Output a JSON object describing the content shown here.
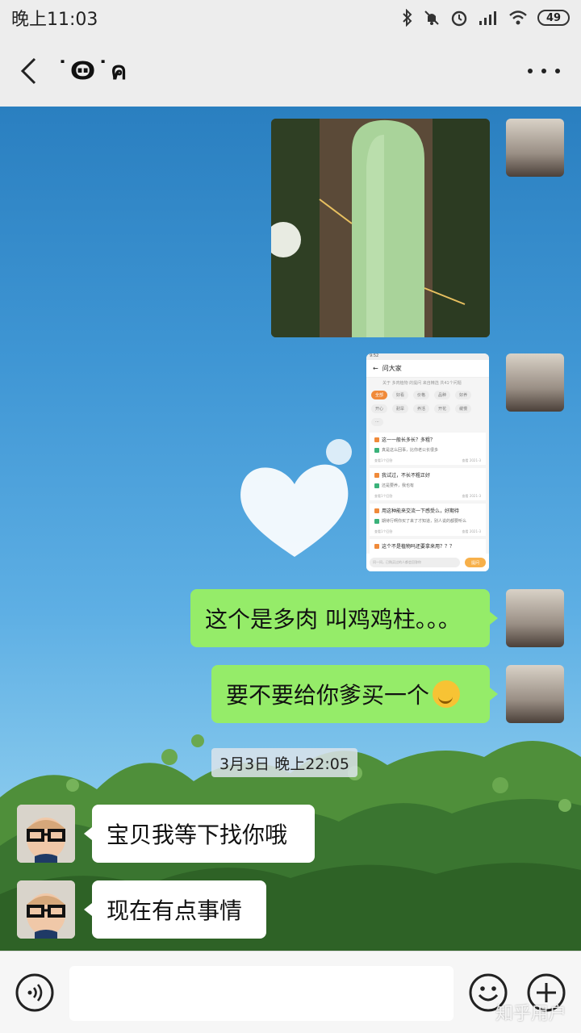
{
  "status_bar": {
    "time": "晚上11:03",
    "battery": "49",
    "icons": [
      "bluetooth-icon",
      "mute-icon",
      "alarm-icon",
      "signal-icon",
      "wifi-icon",
      "battery-icon"
    ]
  },
  "header": {
    "title": "˙Ꙫ˙ค",
    "back_icon": "chevron-left-icon",
    "more_icon": "more-dots-icon"
  },
  "screenshot_preview": {
    "status": "9:52",
    "title": "问大家",
    "subtitle": "关于 多肉植物 的提问 来自精选  共41个问题",
    "tags": [
      "全部",
      "好看",
      "价格",
      "品种",
      "好养",
      "开心",
      "耐旱",
      "养活",
      "开花",
      "缓慢",
      "···"
    ],
    "questions": [
      {
        "q": "这一一般长多长？多粗？",
        "a": "真是这么回事，比你老公长很多",
        "meta_left": "查看1个回答",
        "meta_right": "查看 2021-3"
      },
      {
        "q": "我试过，不长不粗正好",
        "a": "还是要养，我也有",
        "meta_left": "查看1个回答",
        "meta_right": "查看 2021-3"
      },
      {
        "q": "用这种能来交流一下感受么，好期待",
        "a": "期待行啊你买了来了才知道，别人说的都要听么",
        "meta_left": "查看1个回答",
        "meta_right": "查看 2021-3"
      },
      {
        "q": "这个不是植物吗还要拿来用？？？",
        "a": "",
        "meta_left": "",
        "meta_right": ""
      }
    ],
    "input_placeholder": "问一问，已购买过的人都会回答你",
    "send": "提问"
  },
  "messages": [
    {
      "sender": "me",
      "type": "image",
      "content": "cactus-photo"
    },
    {
      "sender": "me",
      "type": "image",
      "content": "screenshot-photo"
    },
    {
      "sender": "me",
      "type": "text",
      "text": "这个是多肉   叫鸡鸡柱。。。"
    },
    {
      "sender": "me",
      "type": "text",
      "text": "要不要给你爹买一个",
      "emoji": "smirk-emoji"
    },
    {
      "sender": "friend",
      "type": "text",
      "text": "宝贝我等下找你哦"
    },
    {
      "sender": "friend",
      "type": "text",
      "text": "现在有点事情"
    }
  ],
  "timestamp": "3月3日 晚上22:05",
  "input_bar": {
    "voice_icon": "voice-icon",
    "emoji_icon": "emoji-icon",
    "plus_icon": "plus-icon",
    "placeholder": ""
  },
  "watermark": "知乎用户",
  "colors": {
    "bubble_me": "#95ec69",
    "bubble_friend": "#ffffff",
    "bar_bg": "#ededed"
  }
}
